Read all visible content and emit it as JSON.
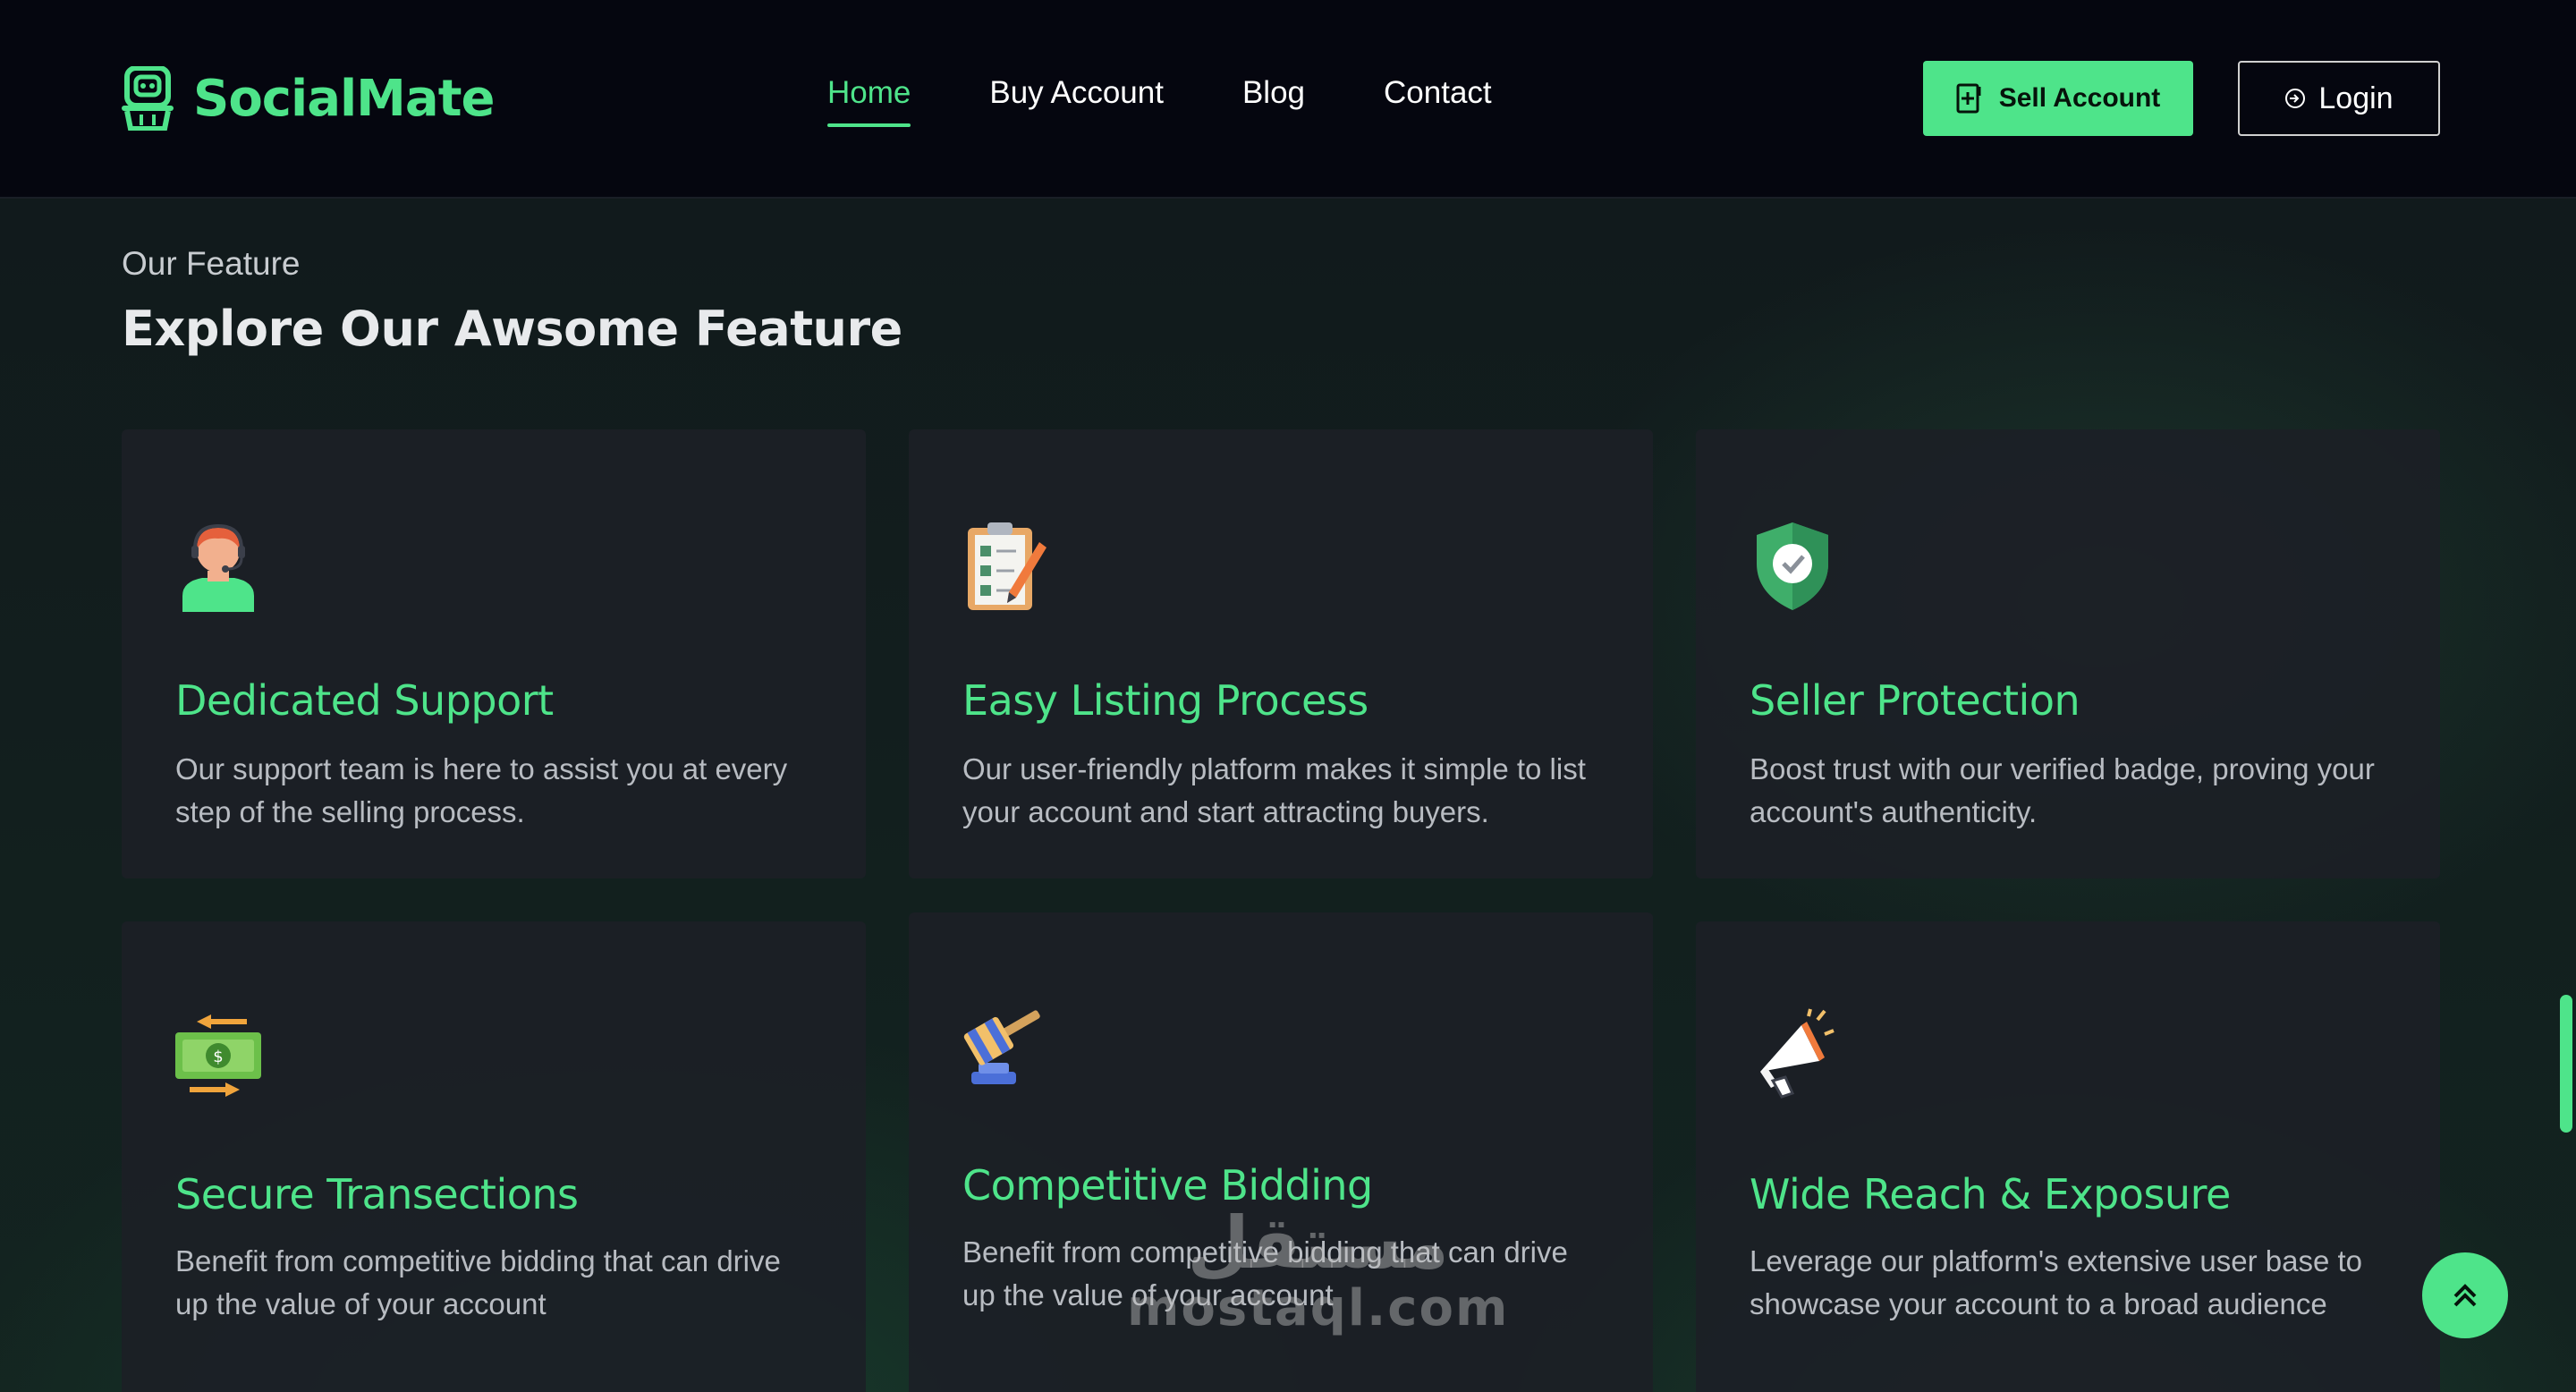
{
  "brand": {
    "name": "SocialMate",
    "accent": "#4ee48a"
  },
  "nav": {
    "items": [
      {
        "label": "Home",
        "active": true
      },
      {
        "label": "Buy Account",
        "active": false
      },
      {
        "label": "Blog",
        "active": false
      },
      {
        "label": "Contact",
        "active": false
      }
    ]
  },
  "header": {
    "sell_label": "Sell Account",
    "login_label": "Login"
  },
  "section": {
    "eyebrow": "Our Feature",
    "title": "Explore Our Awsome Feature"
  },
  "features": [
    {
      "icon": "support-agent-icon",
      "title": "Dedicated Support",
      "desc": "Our support team is here to assist you at every step of the selling process."
    },
    {
      "icon": "clipboard-checklist-icon",
      "title": "Easy Listing Process",
      "desc": "Our user-friendly platform makes it simple to list your account and start attracting buyers."
    },
    {
      "icon": "shield-check-icon",
      "title": "Seller Protection",
      "desc": "Boost trust with our verified badge, proving your account's authenticity."
    },
    {
      "icon": "money-transfer-icon",
      "title": "Secure Transections",
      "desc": "Benefit from competitive bidding that can drive up the value of your account"
    },
    {
      "icon": "gavel-icon",
      "title": "Competitive Bidding",
      "desc": "Benefit from competitive bidding that can drive up the value of your account"
    },
    {
      "icon": "megaphone-icon",
      "title": "Wide Reach & Exposure",
      "desc": "Leverage our platform's extensive user base to showcase your account to a broad audience"
    }
  ],
  "watermark": {
    "arabic": "مستقل",
    "latin": "mostaql.com"
  }
}
